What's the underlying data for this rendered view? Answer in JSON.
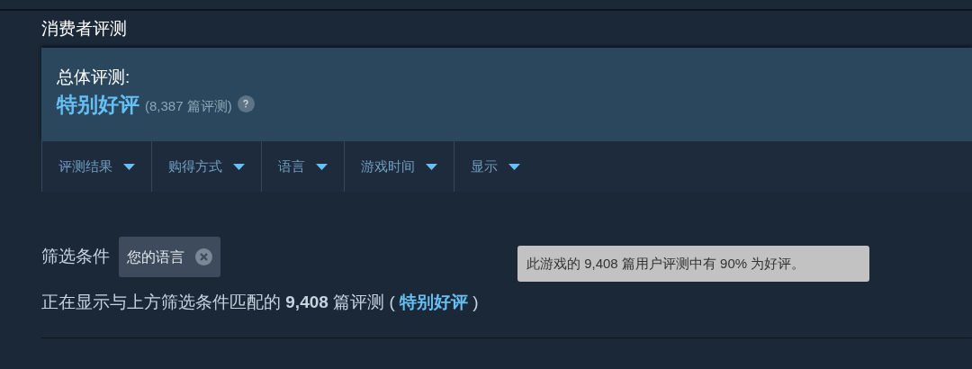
{
  "section_title": "消费者评测",
  "overall": {
    "label": "总体评测:",
    "rating": "特别好评",
    "count": "(8,387 篇评测)"
  },
  "filters": [
    {
      "label": "评测结果"
    },
    {
      "label": "购得方式"
    },
    {
      "label": "语言"
    },
    {
      "label": "游戏时间"
    },
    {
      "label": "显示"
    }
  ],
  "active_filters": {
    "label": "筛选条件",
    "chips": [
      {
        "label": "您的语言"
      }
    ]
  },
  "tooltip": "此游戏的 9,408 篇用户评测中有 90% 为好评。",
  "summary": {
    "prefix": "正在显示与上方筛选条件匹配的 **9,408** 篇评测 (",
    "link": "特别好评",
    "suffix": ")"
  }
}
